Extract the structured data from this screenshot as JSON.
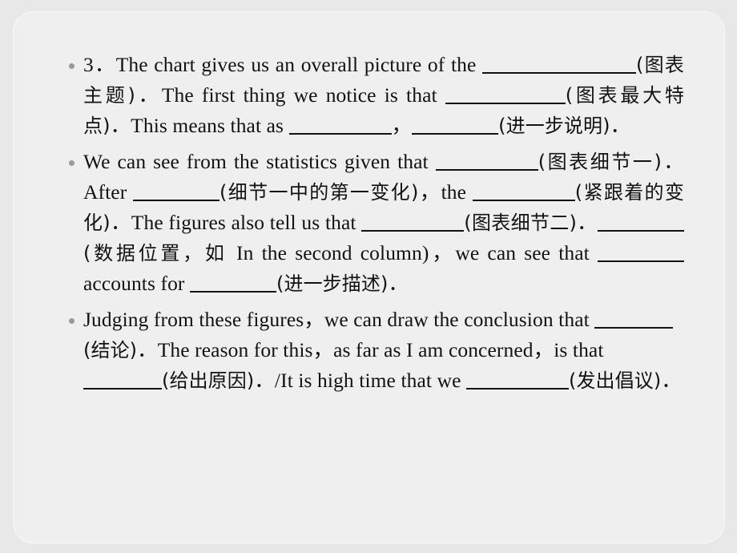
{
  "slide": {
    "background_color": "#e8e8e8",
    "card_color": "#efefef",
    "text_color": "#121212",
    "bullet_color": "#9a9a9a"
  },
  "bullets": [
    {
      "id": "bullet-3",
      "number": "3．",
      "segments": [
        {
          "type": "en",
          "text": "3．"
        },
        {
          "type": "en",
          "text": "The chart gives us an overall picture of the "
        },
        {
          "type": "blank",
          "size": "b-xl"
        },
        {
          "type": "cn",
          "text": "(图表主题)"
        },
        {
          "type": "en",
          "text": "．The first thing we notice is that "
        },
        {
          "type": "blank",
          "size": "b-lg"
        },
        {
          "type": "cn",
          "text": "(图表最大特点)"
        },
        {
          "type": "en",
          "text": "．This means that as "
        },
        {
          "type": "blank",
          "size": "b-md"
        },
        {
          "type": "en",
          "text": "，"
        },
        {
          "type": "blank",
          "size": "b-sm"
        },
        {
          "type": "cn",
          "text": "(进一步说明)"
        },
        {
          "type": "en",
          "text": "．"
        }
      ]
    },
    {
      "id": "bullet-statistics",
      "segments": [
        {
          "type": "en",
          "text": "We can see from the statistics given that "
        },
        {
          "type": "blank",
          "size": "b-md"
        },
        {
          "type": "cn",
          "text": "(图表细节一)"
        },
        {
          "type": "en",
          "text": "．After "
        },
        {
          "type": "blank",
          "size": "b-sm"
        },
        {
          "type": "cn",
          "text": "(细节一中的第一变化)"
        },
        {
          "type": "en",
          "text": "，the "
        },
        {
          "type": "blank",
          "size": "b-md"
        },
        {
          "type": "cn",
          "text": "(紧跟着的变化)"
        },
        {
          "type": "en",
          "text": "．The figures also tell us that "
        },
        {
          "type": "blank",
          "size": "b-md"
        },
        {
          "type": "cn",
          "text": "(图表细节二)"
        },
        {
          "type": "en",
          "text": "．"
        },
        {
          "type": "blank",
          "size": "b-sm"
        },
        {
          "type": "cn",
          "text": "(数据位置，如 "
        },
        {
          "type": "en",
          "text": "In the second column)"
        },
        {
          "type": "en",
          "text": "，we can see that "
        },
        {
          "type": "blank",
          "size": "b-sm"
        },
        {
          "type": "en",
          "text": "accounts for "
        },
        {
          "type": "blank",
          "size": "b-sm"
        },
        {
          "type": "cn",
          "text": "(进一步描述)"
        },
        {
          "type": "en",
          "text": "．"
        }
      ]
    },
    {
      "id": "bullet-conclusion",
      "segments": [
        {
          "type": "en",
          "text": "Judging from these figures，we can draw the conclusion that "
        },
        {
          "type": "blank",
          "size": "b-xs"
        },
        {
          "type": "cn",
          "text": "(结论)"
        },
        {
          "type": "en",
          "text": "．The reason for this，as far as I am concerned，is that "
        },
        {
          "type": "blank",
          "size": "b-xs"
        },
        {
          "type": "cn",
          "text": "(给出原因)"
        },
        {
          "type": "en",
          "text": "．/It is high time that we "
        },
        {
          "type": "blank",
          "size": "b-md"
        },
        {
          "type": "cn",
          "text": "(发出倡议)"
        },
        {
          "type": "en",
          "text": "．"
        }
      ]
    }
  ],
  "text": {
    "p1_a": "3．",
    "p1_b": "The chart gives us an overall picture of the ",
    "p1_cn1": "(图表主题)",
    "p1_c": "．The first thing we notice is that ",
    "p1_cn2": "(图表最大特点)",
    "p1_d": "．This means that as ",
    "p1_comma": "，",
    "p1_cn3": "(进一步说明)",
    "p1_end": "．",
    "p2_a": "We can see from the statistics given that ",
    "p2_cn1": "(图表细节一)",
    "p2_b": "．After ",
    "p2_cn2": "(细节一中的第一变化)",
    "p2_c": "，the ",
    "p2_cn3": "(紧跟着的变化)",
    "p2_d": "．The figures also tell us that ",
    "p2_cn4": "(图表细节二)",
    "p2_e": "．",
    "p2_cn5": "(数据位置，如 ",
    "p2_f": "In the second column)",
    "p2_g": "，we can see that ",
    "p2_h": "accounts for ",
    "p2_cn6": "(进一步描述)",
    "p2_end": "．",
    "p3_a": "Judging from these figures，we can draw the conclusion that ",
    "p3_cn1": "(结论)",
    "p3_b": "．The reason for this，as far as I am concerned，is that ",
    "p3_cn2": "(给出原因)",
    "p3_c": "．/It is high time that we ",
    "p3_cn3": "(发出倡议)",
    "p3_end": "．"
  }
}
